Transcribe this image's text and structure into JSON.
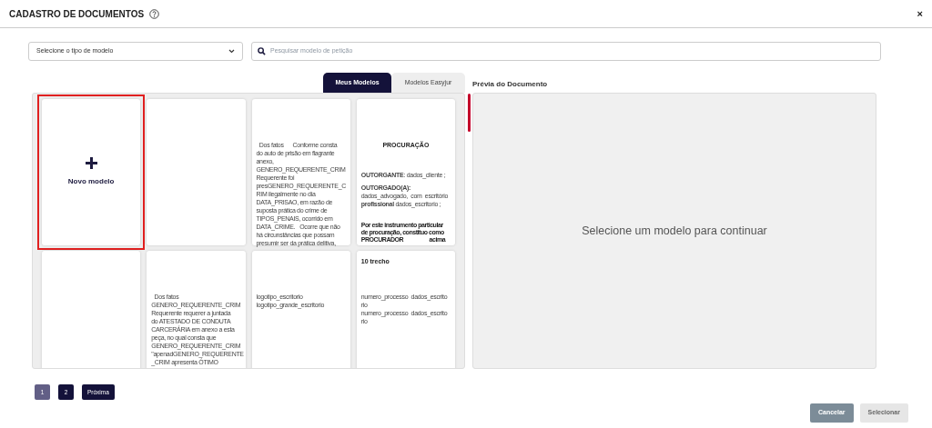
{
  "window": {
    "title": "CADASTRO DE DOCUMENTOS",
    "close": "×"
  },
  "filters": {
    "type_select": {
      "value": "Selecione o tipo de modelo"
    },
    "search": {
      "placeholder": "Pesquisar modelo de petição"
    }
  },
  "tabs": [
    {
      "label": "Meus Modelos",
      "selected": true
    },
    {
      "label": "Modelos Easyjur",
      "selected": false
    }
  ],
  "cards": [
    {
      "kind": "new",
      "label": "Novo modelo",
      "selected": true
    },
    {
      "kind": "doc",
      "selected": false
    },
    {
      "kind": "doc",
      "selected": false,
      "paragraphs": [
        {
          "kind": "text",
          "lines": [
            "  Dos fatos      Conforme consta",
            "do auto de prisão em flagrante",
            "anexo,",
            "GENERO_REQUERENTE_CRIM",
            "Requerente foi",
            "presGENERO_REQUERENTE_C",
            "RIM ilegalmente no dia",
            "DATA_PRISAO, em razão de",
            "suposta prática do crime de",
            "TIPOS_PENAIS, ocorrido em",
            "DATA_CRIME.   Ocorre que não",
            "há circunstâncias que possam",
            "presumir ser da prática delitiva,"
          ]
        }
      ]
    },
    {
      "kind": "doc",
      "selected": false,
      "paragraphs": [
        {
          "kind": "heading",
          "lines": [
            "PROCURAÇÃO"
          ]
        },
        {
          "kind": "text",
          "lines": [
            "**OUTORGANTE**: dados_cliente ;"
          ]
        },
        {
          "kind": "text",
          "lines": [
            "**OUTORGADO(A):**",
            "dados_advogado,  com  escritório",
            "**profissional** dados_escritorio ;"
          ]
        },
        {
          "kind": "strong",
          "lines": [
            "Por este instrumento particular",
            "de procuração, constituo como",
            "PROCURADOR                   acima"
          ]
        }
      ]
    },
    {
      "kind": "doc",
      "selected": false
    },
    {
      "kind": "doc",
      "selected": false,
      "paragraphs": [
        {
          "kind": "text",
          "lines": [
            "  Dos fatos",
            "GENERO_REQUERENTE_CRIM",
            "Requerente requerer a juntada",
            "do ATESTADO DE CONDUTA",
            "CARCERÁRIA em anexo a esta",
            "peça, no qual consta que",
            "GENERO_REQUERENTE_CRIM",
            "\"apenadGENERO_REQUERENTE",
            "_CRIM apresenta ÓTIMO"
          ]
        }
      ]
    },
    {
      "kind": "doc",
      "selected": false,
      "paragraphs": [
        {
          "kind": "text",
          "lines": [
            "logotipo_escritorio",
            "logotipo_grande_escritorio"
          ]
        }
      ]
    },
    {
      "kind": "doc",
      "selected": false,
      "paragraphs": [
        {
          "kind": "title",
          "lines": [
            "10 trecho"
          ]
        },
        {
          "kind": "text",
          "lines": [
            "numero_processo  dados_escrito",
            "rio",
            "numero_processo  dados_escrito",
            "rio"
          ]
        }
      ]
    }
  ],
  "preview": {
    "title": "Prévia do Documento",
    "message": "Selecione um modelo para continuar"
  },
  "pagination": [
    {
      "label": "1",
      "selected": true
    },
    {
      "label": "2",
      "selected": false
    },
    {
      "label": "Próxima",
      "selected": false
    }
  ],
  "buttons": [
    {
      "label": "Cancelar",
      "kind": "secondary"
    },
    {
      "label": "Selecionar",
      "kind": "disabled"
    }
  ]
}
